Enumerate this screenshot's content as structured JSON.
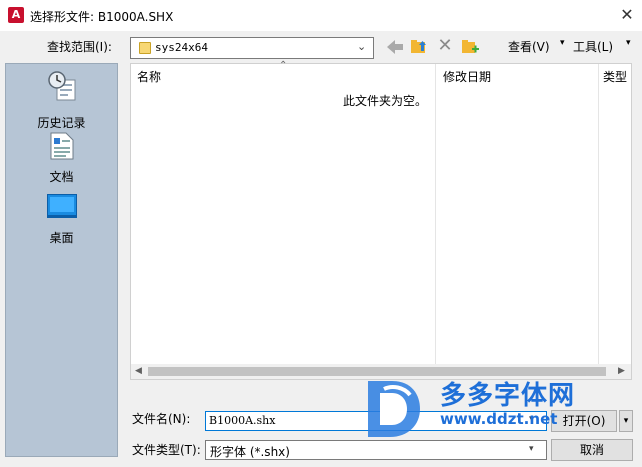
{
  "window": {
    "title": "选择形文件: B1000A.SHX",
    "app_icon_letter": "A",
    "close_glyph": "✕"
  },
  "toolbar": {
    "lookin_label": "查找范围(I):",
    "lookin_value": "sys24x64",
    "view_label": "查看(V)",
    "tools_label": "工具(L)",
    "icons": [
      "back-arrow-icon",
      "up-folder-icon",
      "delete-icon",
      "new-folder-icon"
    ]
  },
  "places": [
    {
      "label": "历史记录",
      "icon": "history-icon"
    },
    {
      "label": "文档",
      "icon": "documents-icon"
    },
    {
      "label": "桌面",
      "icon": "desktop-icon"
    }
  ],
  "filelist": {
    "columns": [
      "名称",
      "修改日期",
      "类型"
    ],
    "empty_message": "此文件夹为空。"
  },
  "bottom": {
    "filename_label": "文件名(N):",
    "filename_value": "B1000A.shx",
    "filetype_label": "文件类型(T):",
    "filetype_value": "形字体 (*.shx)",
    "open_label": "打开(O)",
    "cancel_label": "取消"
  },
  "watermark": {
    "text": "多多字体网",
    "url": "www.ddzt.net"
  },
  "colors": {
    "places_bg": "#b6c5d5",
    "accent": "#0078d7",
    "watermark": "#1e6fd8",
    "app_icon": "#c8102e"
  }
}
